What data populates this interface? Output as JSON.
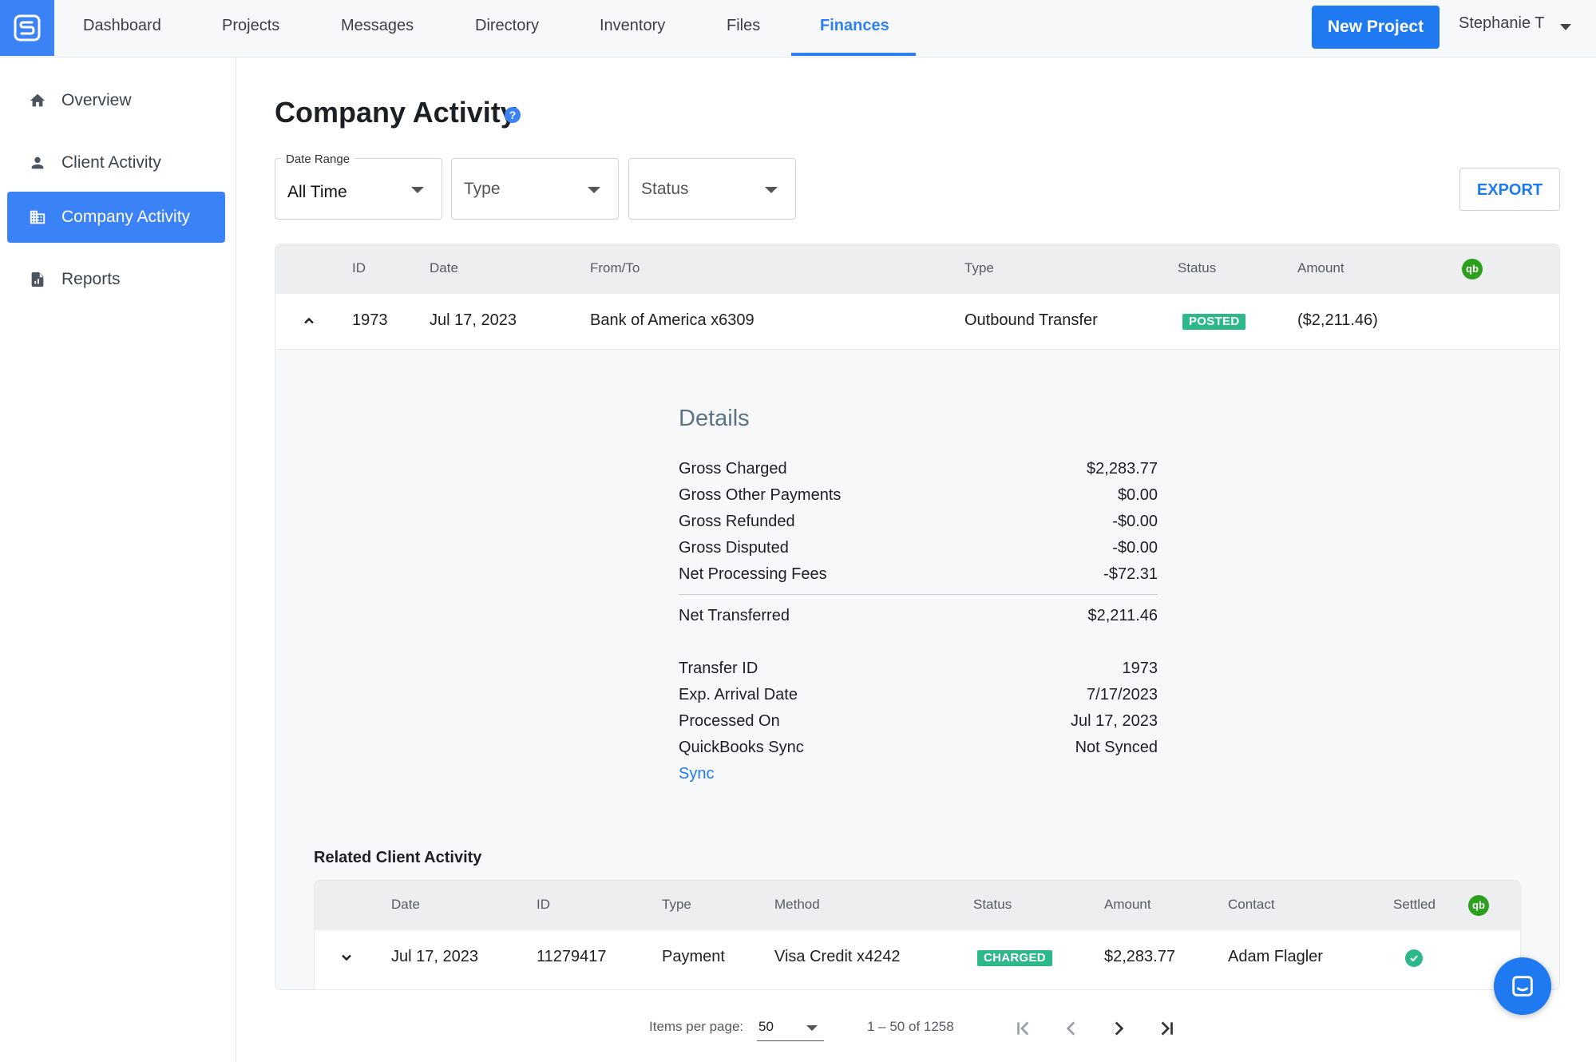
{
  "nav": {
    "items": [
      "Dashboard",
      "Projects",
      "Messages",
      "Directory",
      "Inventory",
      "Files",
      "Finances"
    ],
    "active": "Finances",
    "new_project_label": "New Project",
    "user_name": "Stephanie T"
  },
  "sidebar": {
    "items": [
      {
        "label": "Overview",
        "icon": "home-icon"
      },
      {
        "label": "Client Activity",
        "icon": "person-icon"
      },
      {
        "label": "Company Activity",
        "icon": "building-icon"
      },
      {
        "label": "Reports",
        "icon": "report-icon"
      }
    ],
    "active": "Company Activity"
  },
  "page": {
    "title": "Company Activity"
  },
  "filters": {
    "date_range_label": "Date Range",
    "date_range_value": "All Time",
    "type_placeholder": "Type",
    "status_placeholder": "Status",
    "export_label": "EXPORT"
  },
  "table": {
    "columns": [
      "ID",
      "Date",
      "From/To",
      "Type",
      "Status",
      "Amount"
    ],
    "quickbooks_icon_text": "qb",
    "row": {
      "id": "1973",
      "date": "Jul 17, 2023",
      "from_to": "Bank of America x6309",
      "type": "Outbound Transfer",
      "status": "POSTED",
      "amount": "($2,211.46)"
    }
  },
  "details": {
    "title": "Details",
    "lines": [
      {
        "label": "Gross Charged",
        "value": "$2,283.77"
      },
      {
        "label": "Gross Other Payments",
        "value": "$0.00"
      },
      {
        "label": "Gross Refunded",
        "value": "-$0.00"
      },
      {
        "label": "Gross Disputed",
        "value": "-$0.00"
      },
      {
        "label": "Net Processing Fees",
        "value": "-$72.31"
      }
    ],
    "net": {
      "label": "Net Transferred",
      "value": "$2,211.46"
    },
    "info": [
      {
        "label": "Transfer ID",
        "value": "1973"
      },
      {
        "label": "Exp. Arrival Date",
        "value": "7/17/2023"
      },
      {
        "label": "Processed On",
        "value": "Jul 17, 2023"
      },
      {
        "label": "QuickBooks Sync",
        "value": "Not Synced"
      }
    ],
    "sync_link": "Sync"
  },
  "related": {
    "title": "Related Client Activity",
    "columns": [
      "Date",
      "ID",
      "Type",
      "Method",
      "Status",
      "Amount",
      "Contact",
      "Settled"
    ],
    "row": {
      "date": "Jul 17, 2023",
      "id": "11279417",
      "type": "Payment",
      "method": "Visa Credit x4242",
      "status": "CHARGED",
      "amount": "$2,283.77",
      "contact": "Adam Flagler"
    }
  },
  "pagination": {
    "items_per_page_label": "Items per page:",
    "items_per_page": "50",
    "range": "1 – 50 of 1258"
  },
  "colors": {
    "primary": "#1f7af2",
    "success": "#2db88a",
    "quickbooks": "#2ca01c"
  }
}
